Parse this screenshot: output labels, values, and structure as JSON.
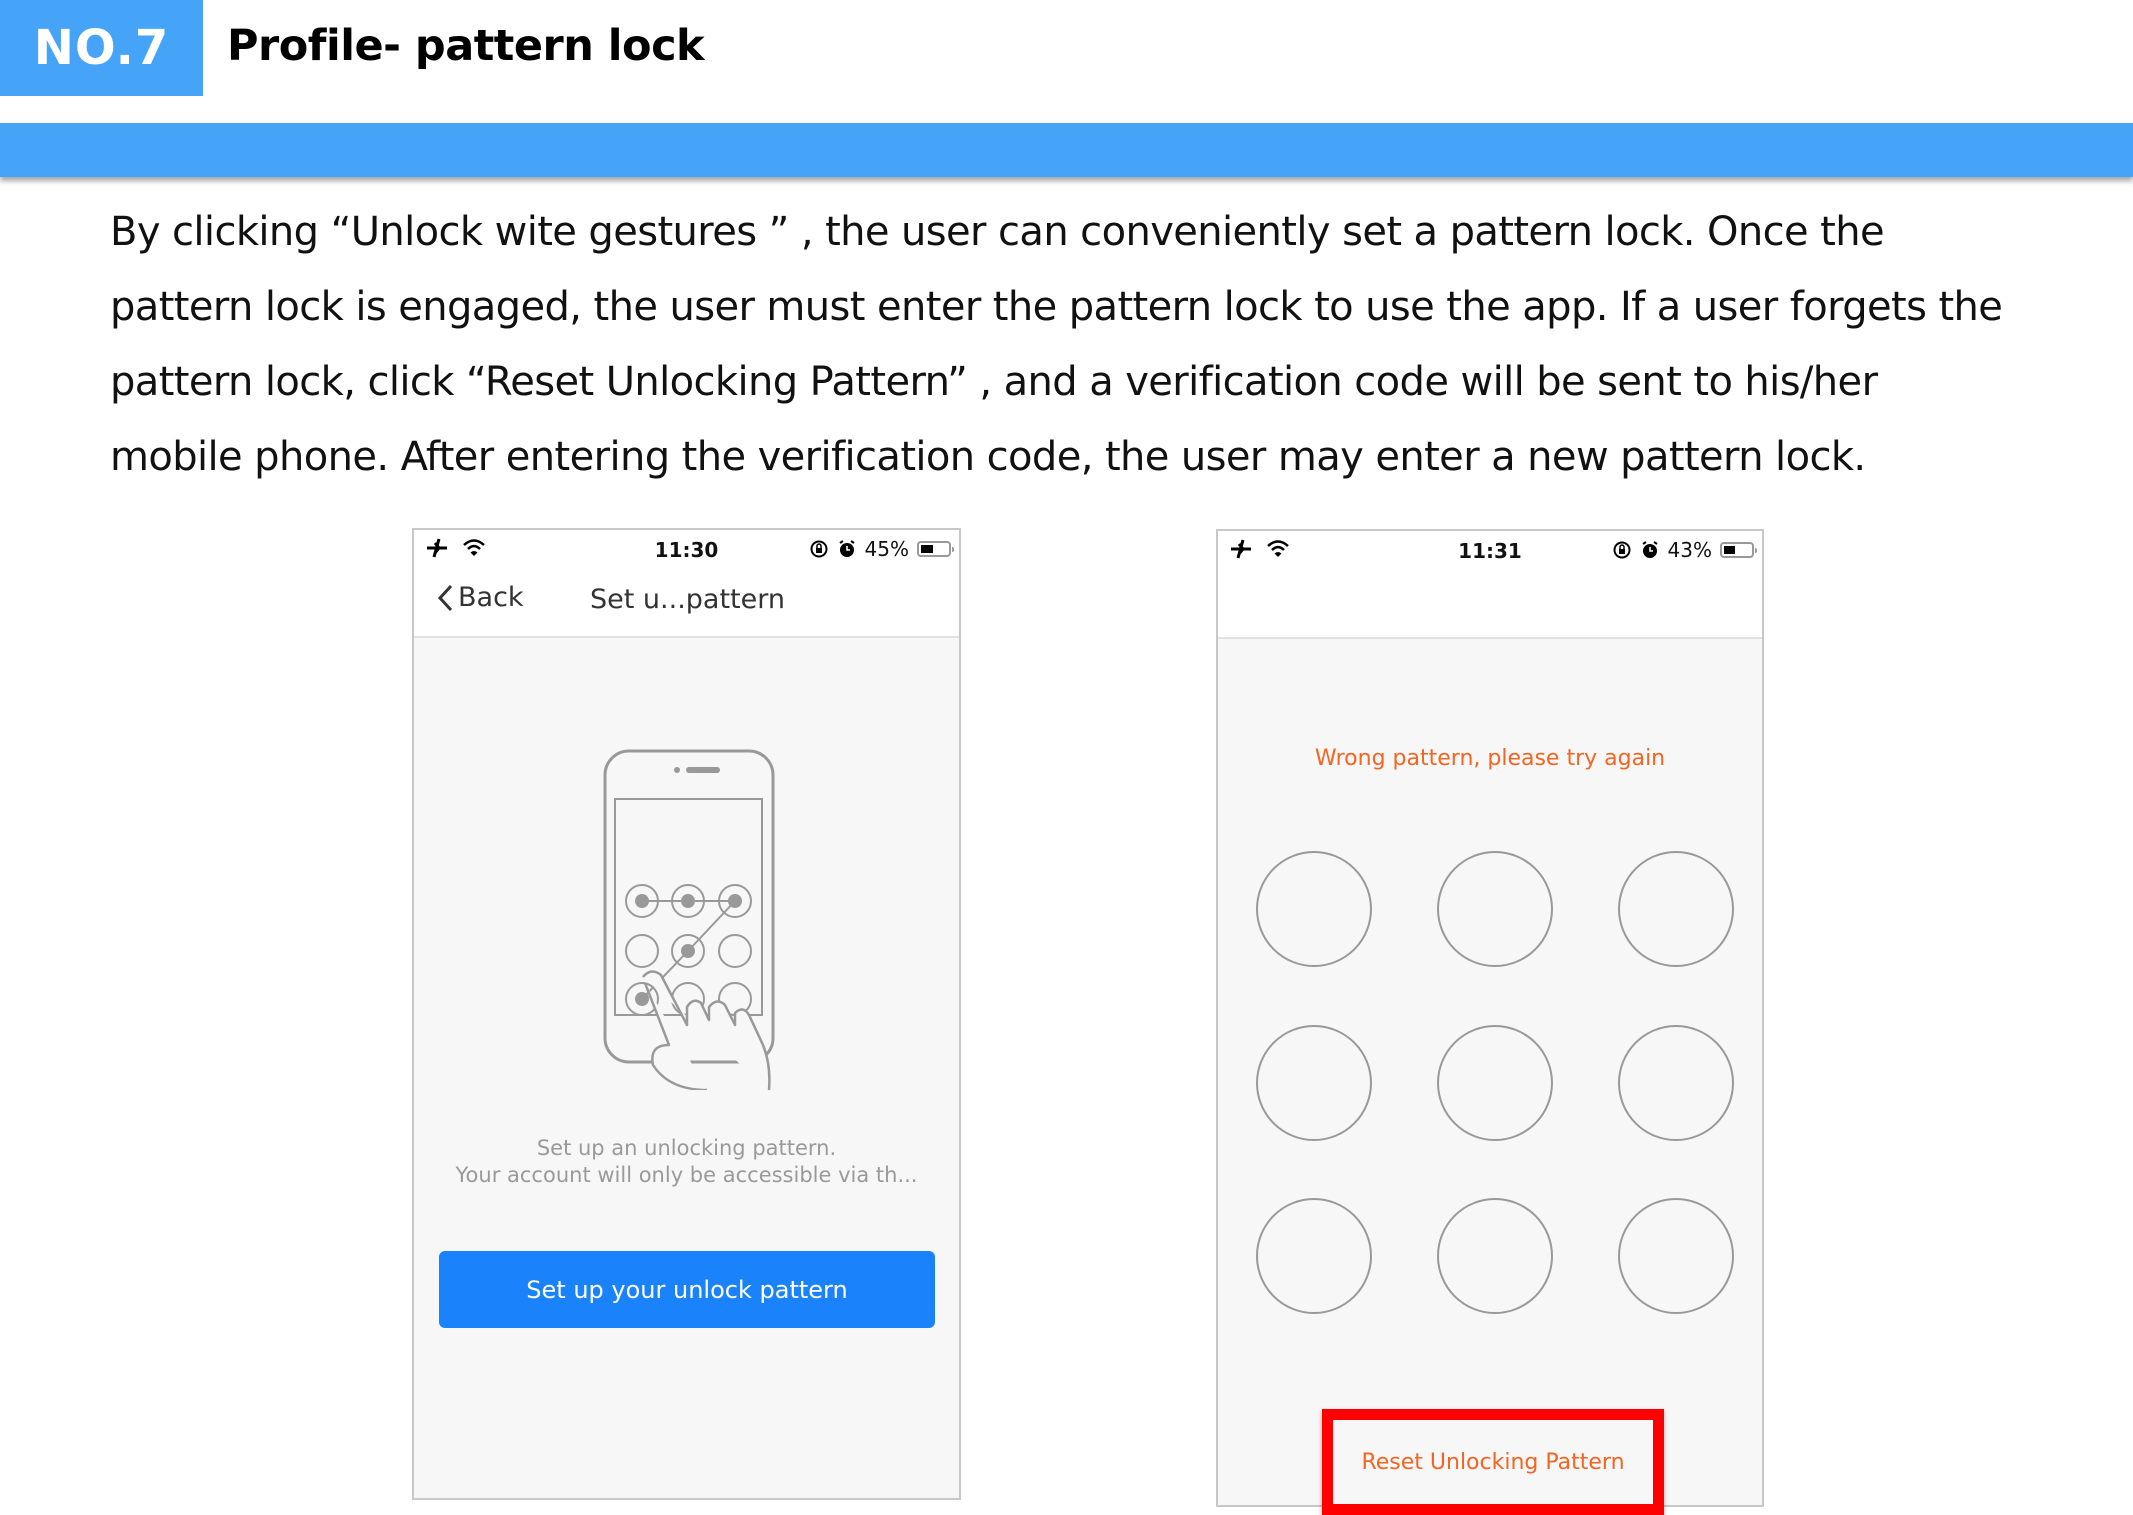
{
  "header": {
    "number_label": "NO.7",
    "title": "Profile- pattern lock"
  },
  "description": {
    "lines": [
      "By clicking   “Unlock wite gestures ”  , the user can conveniently set a pattern lock. Once the",
      "pattern lock is engaged, the user must enter the pattern lock to use the app. If a user forgets the",
      "pattern lock, click   “Reset Unlocking Pattern”  , and a verification code will be sent to his/her",
      "mobile phone. After entering the verification code, the user may enter a new pattern lock."
    ]
  },
  "colors": {
    "accent_blue": "#46A4F8",
    "button_blue": "#1A82FB",
    "error_orange": "#F26522",
    "highlight_red": "#FF0000"
  },
  "phone_left": {
    "status": {
      "icons_left": [
        "airplane-icon",
        "wifi-icon"
      ],
      "time": "11:30",
      "icons_right": [
        "rotation-lock-icon",
        "alarm-icon"
      ],
      "battery_percent_label": "45%",
      "battery_level": 0.45
    },
    "nav": {
      "back_label": "Back",
      "title": "Set u...pattern"
    },
    "illustration": {
      "grid_size": 3,
      "selected_points": [
        [
          0,
          0
        ],
        [
          0,
          1
        ],
        [
          0,
          2
        ],
        [
          1,
          1
        ],
        [
          2,
          0
        ]
      ]
    },
    "hint_line1": "Set up an unlocking pattern.",
    "hint_line2": "Your account will only be accessible via th...",
    "primary_button": "Set up your unlock pattern"
  },
  "phone_right": {
    "status": {
      "icons_left": [
        "airplane-icon",
        "wifi-icon"
      ],
      "time": "11:31",
      "icons_right": [
        "rotation-lock-icon",
        "alarm-icon"
      ],
      "battery_percent_label": "43%",
      "battery_level": 0.43
    },
    "error_message": "Wrong pattern, please try again",
    "pattern_grid": {
      "rows": 3,
      "cols": 3
    },
    "reset_button": "Reset Unlocking Pattern"
  }
}
